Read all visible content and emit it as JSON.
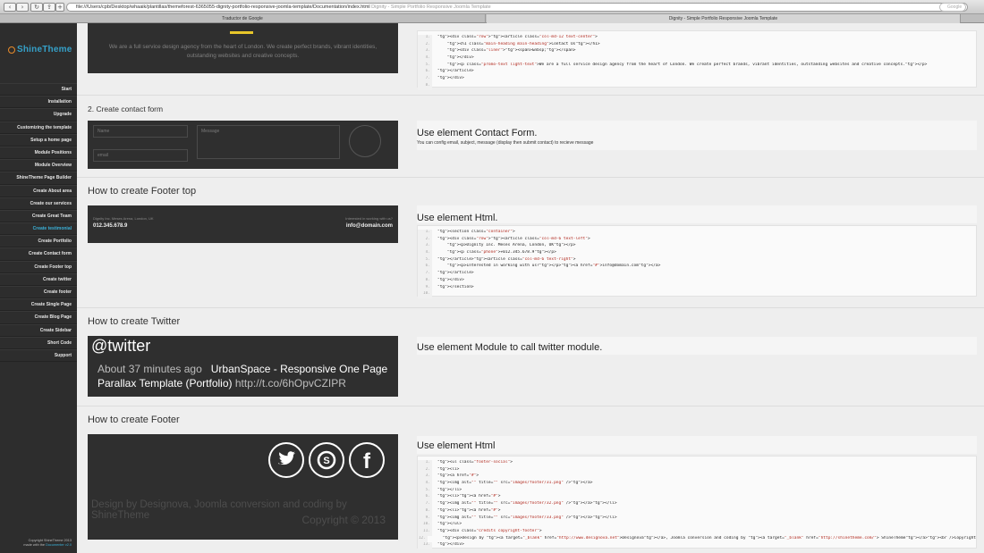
{
  "browser": {
    "url": "file:///Users/cpb/Desktop/whaaik/plantillas/themeforest-6365055-dignity-portfolio-responsive-joomla-template/Documentation/index.html",
    "url_hint": "Dignity - Simple Portfolio Responsive Joomla Template",
    "search_placeholder": "Google",
    "tabs": [
      "Traductor de Google",
      "Dignity - Simple Portfolio Responsive Joomla Template"
    ]
  },
  "sidebar": {
    "logo": "ShineTheme",
    "items": [
      {
        "label": "Start"
      },
      {
        "label": "Installation"
      },
      {
        "label": "Upgrade"
      },
      {
        "label": "Customizing the template"
      },
      {
        "label": "Setup a home page"
      },
      {
        "label": "Module Positions"
      },
      {
        "label": "Module Overview"
      },
      {
        "label": "ShineTheme Page Builder"
      },
      {
        "label": "Create About area"
      },
      {
        "label": "Create our services"
      },
      {
        "label": "Create Great Team"
      },
      {
        "label": "Create testimonial"
      },
      {
        "label": "Create Portfolio"
      },
      {
        "label": "Create Contact form"
      },
      {
        "label": "Create Footer top"
      },
      {
        "label": "Create twitter"
      },
      {
        "label": "Create footer"
      },
      {
        "label": "Create Single Page"
      },
      {
        "label": "Create Blog Page"
      },
      {
        "label": "Create Sidebar"
      },
      {
        "label": "Short Code"
      },
      {
        "label": "Support"
      }
    ],
    "active_index": 11,
    "footer_line1": "Copyright ShineTheme 2013",
    "footer_line2_prefix": "made with the",
    "footer_line2_link": "Documenter v2.0"
  },
  "section_top": {
    "preview_text": "We are a full service design agency from the heart of London. We create perfect brands, vibrant identities, outstanding websites and creative concepts.",
    "code_lines": [
      "<div class=\"row\"><article class=\"col-md-12 text-center\">",
      "    <h1 class=\"main-heading main-heading\">Contact Us</h1>",
      "    <div class=\"liner\"><span>&nbsp;</span>",
      "    </div>",
      "    <p class=\"promo-text light-text\">We are a full service design agency from the heart of London. We create perfect brands, vibrant identities, outstanding websites and creative concepts.</p>",
      "</article>",
      "</div>",
      ""
    ]
  },
  "section_contact": {
    "title": "2. Create contact form",
    "field_name": "Name",
    "field_email": "email",
    "field_message": "Message",
    "right_title": "Use element Contact Form.",
    "right_desc": "You can config email, subject, message (display then submit contact) to recieve message"
  },
  "section_footer_top": {
    "title": "How to create Footer top",
    "address": "Dignity Inc. Meses Arena, London, UK",
    "phone": "012.345.678.9",
    "interest": "Interested in working with us?",
    "email": "info@domain.com",
    "right_title": "Use element Html.",
    "code_lines": [
      "<section class=\"container\">",
      "<div class=\"row\"><article class=\"col-md-6 text-left\">",
      "    <p>Dignity Inc. Meses Arena, London, UK</p>",
      "    <p class=\"phone\">+012.345.678.9</p>",
      "</article><article class=\"col-md-6 text-right\">",
      "    <p>Interested in working with us?</p><a href=\"#\">info@domain.com</a>",
      "</article>",
      "</div>",
      "</section>",
      ""
    ]
  },
  "section_twitter": {
    "title": "How to create Twitter",
    "handle": "@twitter",
    "time": "About 37 minutes ago",
    "tweet": "UrbanSpace - Responsive One Page Parallax Template (Portfolio)",
    "link": "http://t.co/6hOpvCZIPR",
    "right_title": "Use element Module to call twitter module."
  },
  "section_footer": {
    "title": "How to create Footer",
    "credit": "Design by Designova, Joomla conversion and coding by ShineTheme",
    "copyright": "Copyright © 2013",
    "right_title": "Use element Html",
    "code_lines": [
      "<ul class=\"footer-social\">",
      "<li>",
      "<a href=\"#\">",
      "<img alt=\"\" title=\"\" src=\"images/footer/31.png\" /></a>",
      "</li>",
      "<li><a href=\"#\">",
      "<img alt=\"\" title=\"\" src=\"images/footer/32.png\" /></a></li>",
      "<li><a href=\"#\">",
      "<img alt=\"\" title=\"\" src=\"images/footer/33.png\" /></a></li>",
      "</ul>",
      "<div class=\"credits copyright-footer\">",
      "    <p>Design by <a target=\"_blank\" href=\"http://www.designova.net\">Designova</a>, Joomla conversion and coding by <a target=\"_blank\" href=\"http://shinetheme.com/\"> ShineTheme</a><br />Copyright",
      "</div>"
    ]
  }
}
